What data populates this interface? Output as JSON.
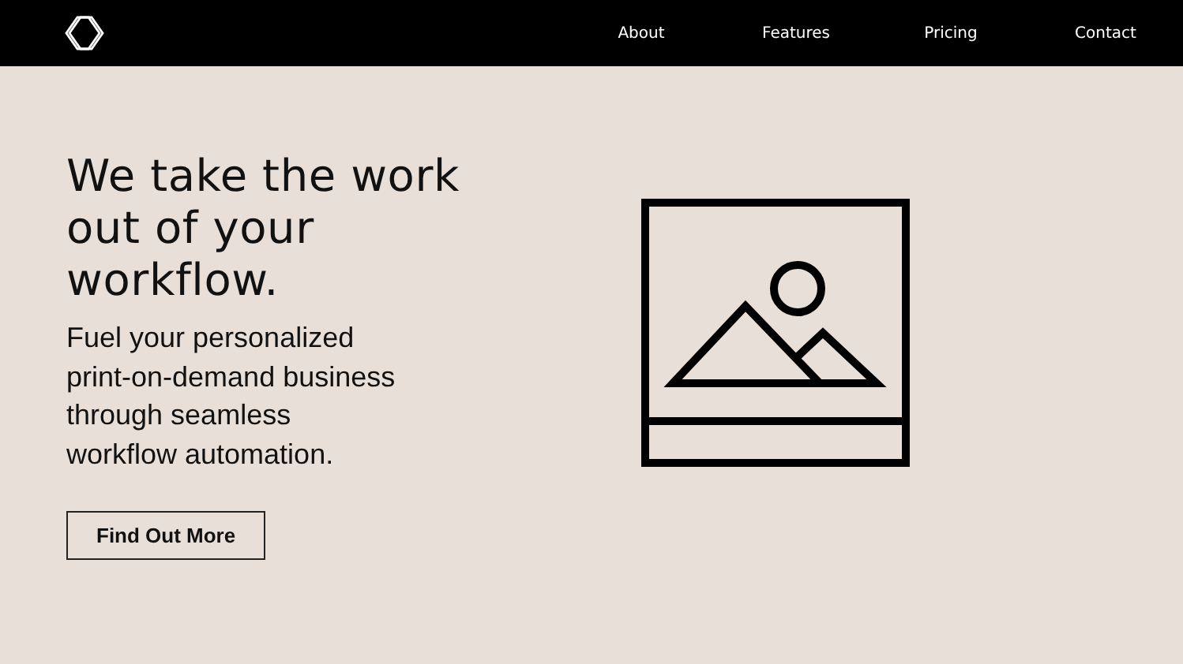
{
  "nav": {
    "links": [
      {
        "label": "About"
      },
      {
        "label": "Features"
      },
      {
        "label": "Pricing"
      },
      {
        "label": "Contact"
      }
    ]
  },
  "hero": {
    "heading": "We take the work\nout of your\nworkflow.",
    "text": "Fuel your personalized\nprint-on-demand business\nthrough seamless\nworkflow automation.",
    "button": "Find Out More"
  }
}
